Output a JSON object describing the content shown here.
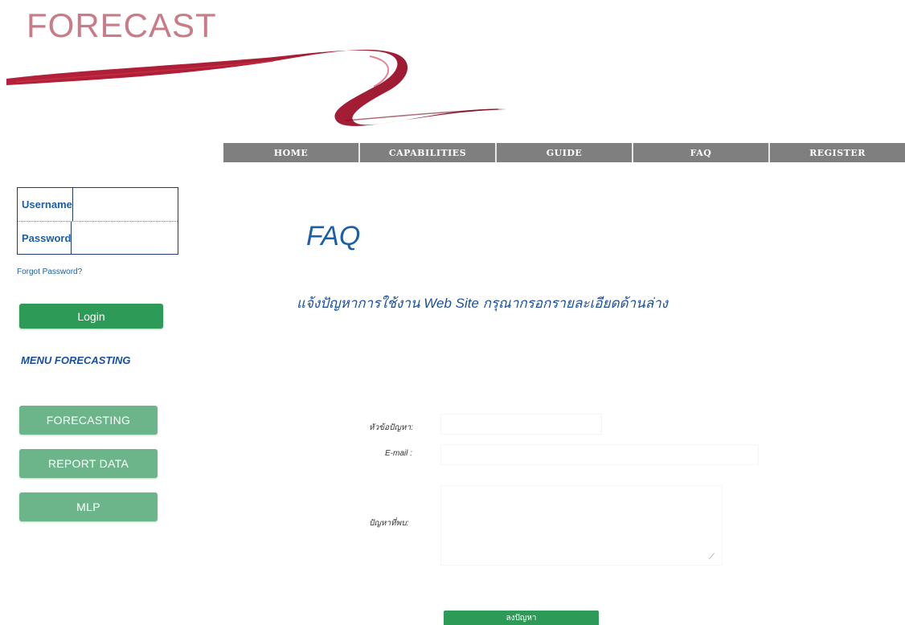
{
  "header": {
    "logo_text": "FORECAST"
  },
  "nav": {
    "items": [
      {
        "label": "HOME"
      },
      {
        "label": "CAPABILITIES"
      },
      {
        "label": "GUIDE"
      },
      {
        "label": "FAQ"
      },
      {
        "label": "REGISTER"
      }
    ]
  },
  "sidebar": {
    "login": {
      "username_label": "Username",
      "password_label": "Password",
      "username_value": "",
      "password_value": "",
      "forgot_label": "Forgot Password?",
      "login_button": "Login"
    },
    "menu_title": "MENU FORECASTING",
    "menu_buttons": [
      {
        "label": "FORECASTING"
      },
      {
        "label": "REPORT  DATA"
      },
      {
        "label": "MLP"
      }
    ]
  },
  "main": {
    "title": "FAQ",
    "subtitle": "แจ้งปัญหาการใช้งาน Web Site กรุณากรอกรายละเอียดด้านล่าง",
    "form": {
      "subject_label": "หัวข้อปัญหา:",
      "email_label": "E-mail :",
      "problem_label": "ปัญหาที่พบ:",
      "subject_value": "",
      "email_value": "",
      "problem_value": "",
      "submit_label": "ลงปัญหา"
    }
  },
  "colors": {
    "brand": "#c97c88",
    "brush": "#a8122c",
    "nav_bg": "#7f7f7f",
    "accent_blue": "#1a5fa8",
    "button_green": "#2e9a58",
    "menu_green": "#6cb58a"
  },
  "icons": {
    "resize_grip": "resize-grip-icon",
    "brush_stroke": "brush-stroke-logo"
  }
}
